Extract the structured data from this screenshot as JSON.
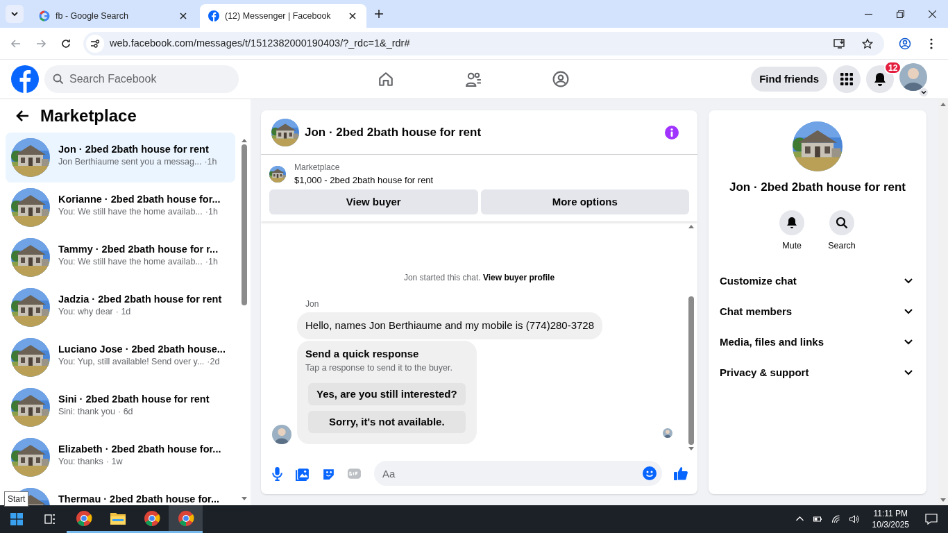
{
  "browser": {
    "tabs": [
      {
        "title": "fb - Google Search",
        "kind": "google",
        "selected": false
      },
      {
        "title": "(12) Messenger | Facebook",
        "kind": "facebook",
        "selected": true
      }
    ],
    "url": "web.facebook.com/messages/t/1512382000190403/?_rdc=1&_rdr#"
  },
  "header": {
    "search_placeholder": "Search Facebook",
    "find_friends": "Find friends",
    "notification_count": "12"
  },
  "sidebar": {
    "title": "Marketplace",
    "conversations": [
      {
        "title": "Jon · 2bed 2bath house for rent",
        "preview": "Jon Berthiaume sent you a messag...",
        "time": "·1h",
        "selected": true
      },
      {
        "title": "Korianne · 2bed 2bath house for...",
        "preview": "You: We still have the home availab...",
        "time": "·1h",
        "selected": false
      },
      {
        "title": "Tammy · 2bed 2bath house for r...",
        "preview": "You: We still have the home availab...",
        "time": "·1h",
        "selected": false
      },
      {
        "title": "Jadzia · 2bed 2bath house for rent",
        "preview": "You: why dear",
        "time": "· 1d",
        "selected": false
      },
      {
        "title": "Luciano Jose · 2bed 2bath house...",
        "preview": "You: Yup, still available! Send over y...",
        "time": "·2d",
        "selected": false
      },
      {
        "title": "Sini · 2bed 2bath house for rent",
        "preview": "Sini: thank you",
        "time": "· 6d",
        "selected": false
      },
      {
        "title": "Elizabeth · 2bed 2bath house for...",
        "preview": "You: thanks",
        "time": "· 1w",
        "selected": false
      },
      {
        "title": "Thermau · 2bed 2bath house for...",
        "selected": false
      }
    ]
  },
  "chat": {
    "title": "Jon · 2bed 2bath house for rent",
    "listing_label": "Marketplace",
    "listing": "$1,000 - 2bed 2bath house for rent",
    "buttons": [
      "View buyer",
      "More options"
    ],
    "system_text": "Jon started this chat.",
    "system_link": "View buyer profile",
    "sender": "Jon",
    "message": "Hello, names Jon Berthiaume and my mobile is (774)280-3728",
    "quick_title": "Send a quick response",
    "quick_subtitle": "Tap a response to send it to the buyer.",
    "quick_options": [
      "Yes, are you still interested?",
      "Sorry, it's not available."
    ],
    "composer_placeholder": "Aa"
  },
  "details": {
    "title": "Jon · 2bed 2bath house for rent",
    "actions": [
      {
        "label": "Mute",
        "kind": "bell"
      },
      {
        "label": "Search",
        "kind": "search"
      }
    ],
    "sections": [
      "Customize chat",
      "Chat members",
      "Media, files and links",
      "Privacy & support"
    ]
  },
  "taskbar": {
    "tooltip": "Start",
    "time": "11:11 PM",
    "date": "10/3/2025"
  }
}
